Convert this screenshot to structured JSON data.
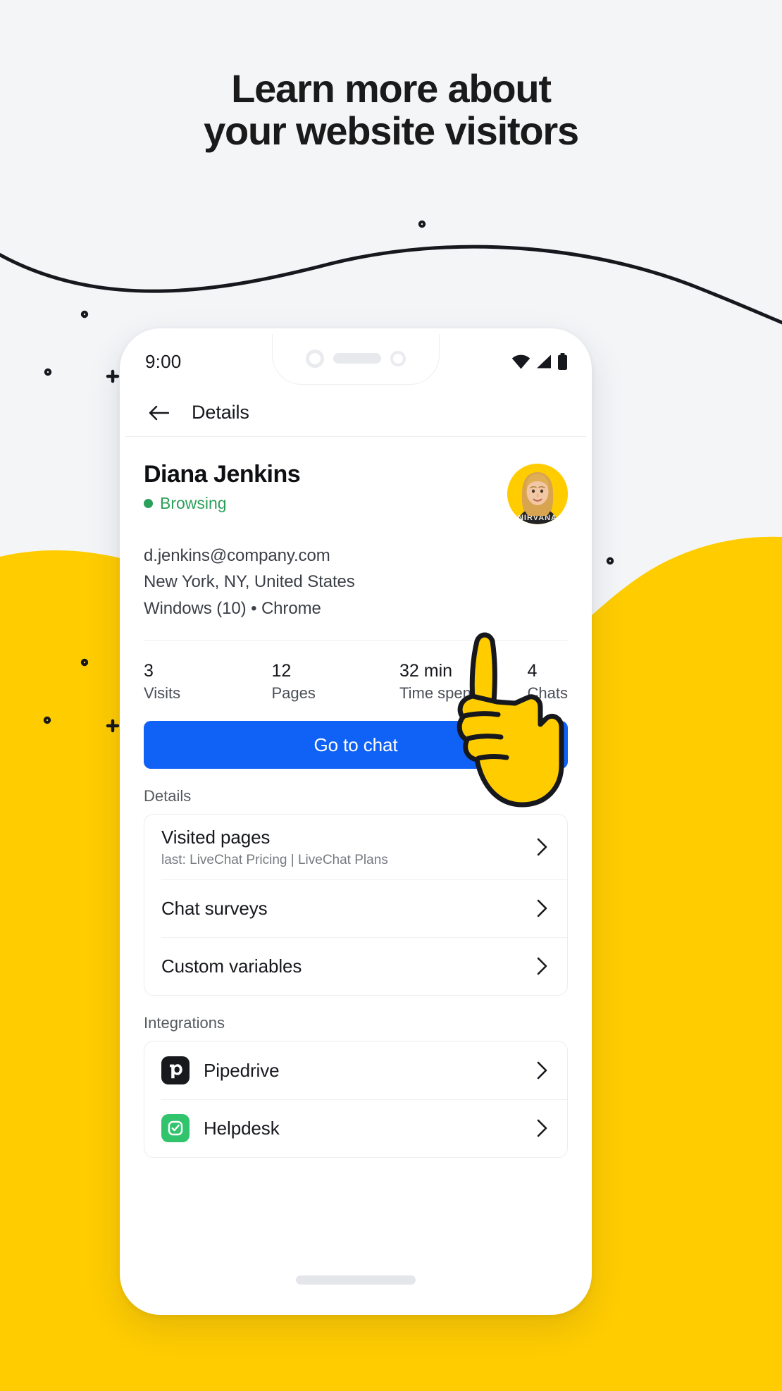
{
  "headline": {
    "line1": "Learn more about",
    "line2": "your website visitors"
  },
  "colors": {
    "page_background": "#f4f5f7",
    "brand_yellow": "#ffcc00",
    "primary_blue": "#1061f5",
    "online_green": "#2aa05a",
    "helpdesk_green": "#32c46d",
    "pipedrive_black": "#17191c",
    "ink": "#16181d"
  },
  "phone": {
    "status_bar": {
      "time": "9:00",
      "icons": [
        "wifi-icon",
        "cellular-signal-icon",
        "battery-icon"
      ]
    },
    "app_bar": {
      "back_icon": "arrow-left-icon",
      "title": "Details"
    },
    "profile": {
      "name": "Diana Jenkins",
      "presence_status": "Browsing",
      "presence_icon": "online-dot-icon",
      "avatar_icon": "avatar",
      "meta": [
        "d.jenkins@company.com",
        "New York, NY, United States",
        "Windows (10) • Chrome"
      ]
    },
    "stats": [
      {
        "value": "3",
        "label": "Visits"
      },
      {
        "value": "12",
        "label": "Pages"
      },
      {
        "value": "32 min",
        "label": "Time spent"
      },
      {
        "value": "4",
        "label": "Chats"
      }
    ],
    "primary_action": {
      "label": "Go to chat"
    },
    "details_section": {
      "title": "Details",
      "items": [
        {
          "title": "Visited pages",
          "subtitle": "last: LiveChat Pricing | LiveChat Plans",
          "chevron_icon": "chevron-right-icon"
        },
        {
          "title": "Chat surveys",
          "subtitle": "",
          "chevron_icon": "chevron-right-icon"
        },
        {
          "title": "Custom variables",
          "subtitle": "",
          "chevron_icon": "chevron-right-icon"
        }
      ]
    },
    "integrations_section": {
      "title": "Integrations",
      "items": [
        {
          "title": "Pipedrive",
          "icon": "pipedrive-logo-icon",
          "chevron_icon": "chevron-right-icon"
        },
        {
          "title": "Helpdesk",
          "icon": "helpdesk-logo-icon",
          "chevron_icon": "chevron-right-icon"
        }
      ]
    },
    "home_indicator_icon": "home-indicator"
  },
  "decoration": {
    "pointing_hand_icon": "pointing-hand-icon",
    "curve_icon": "arc-line",
    "dot_icon": "dot-marker",
    "plus_icon": "plus-marker"
  }
}
